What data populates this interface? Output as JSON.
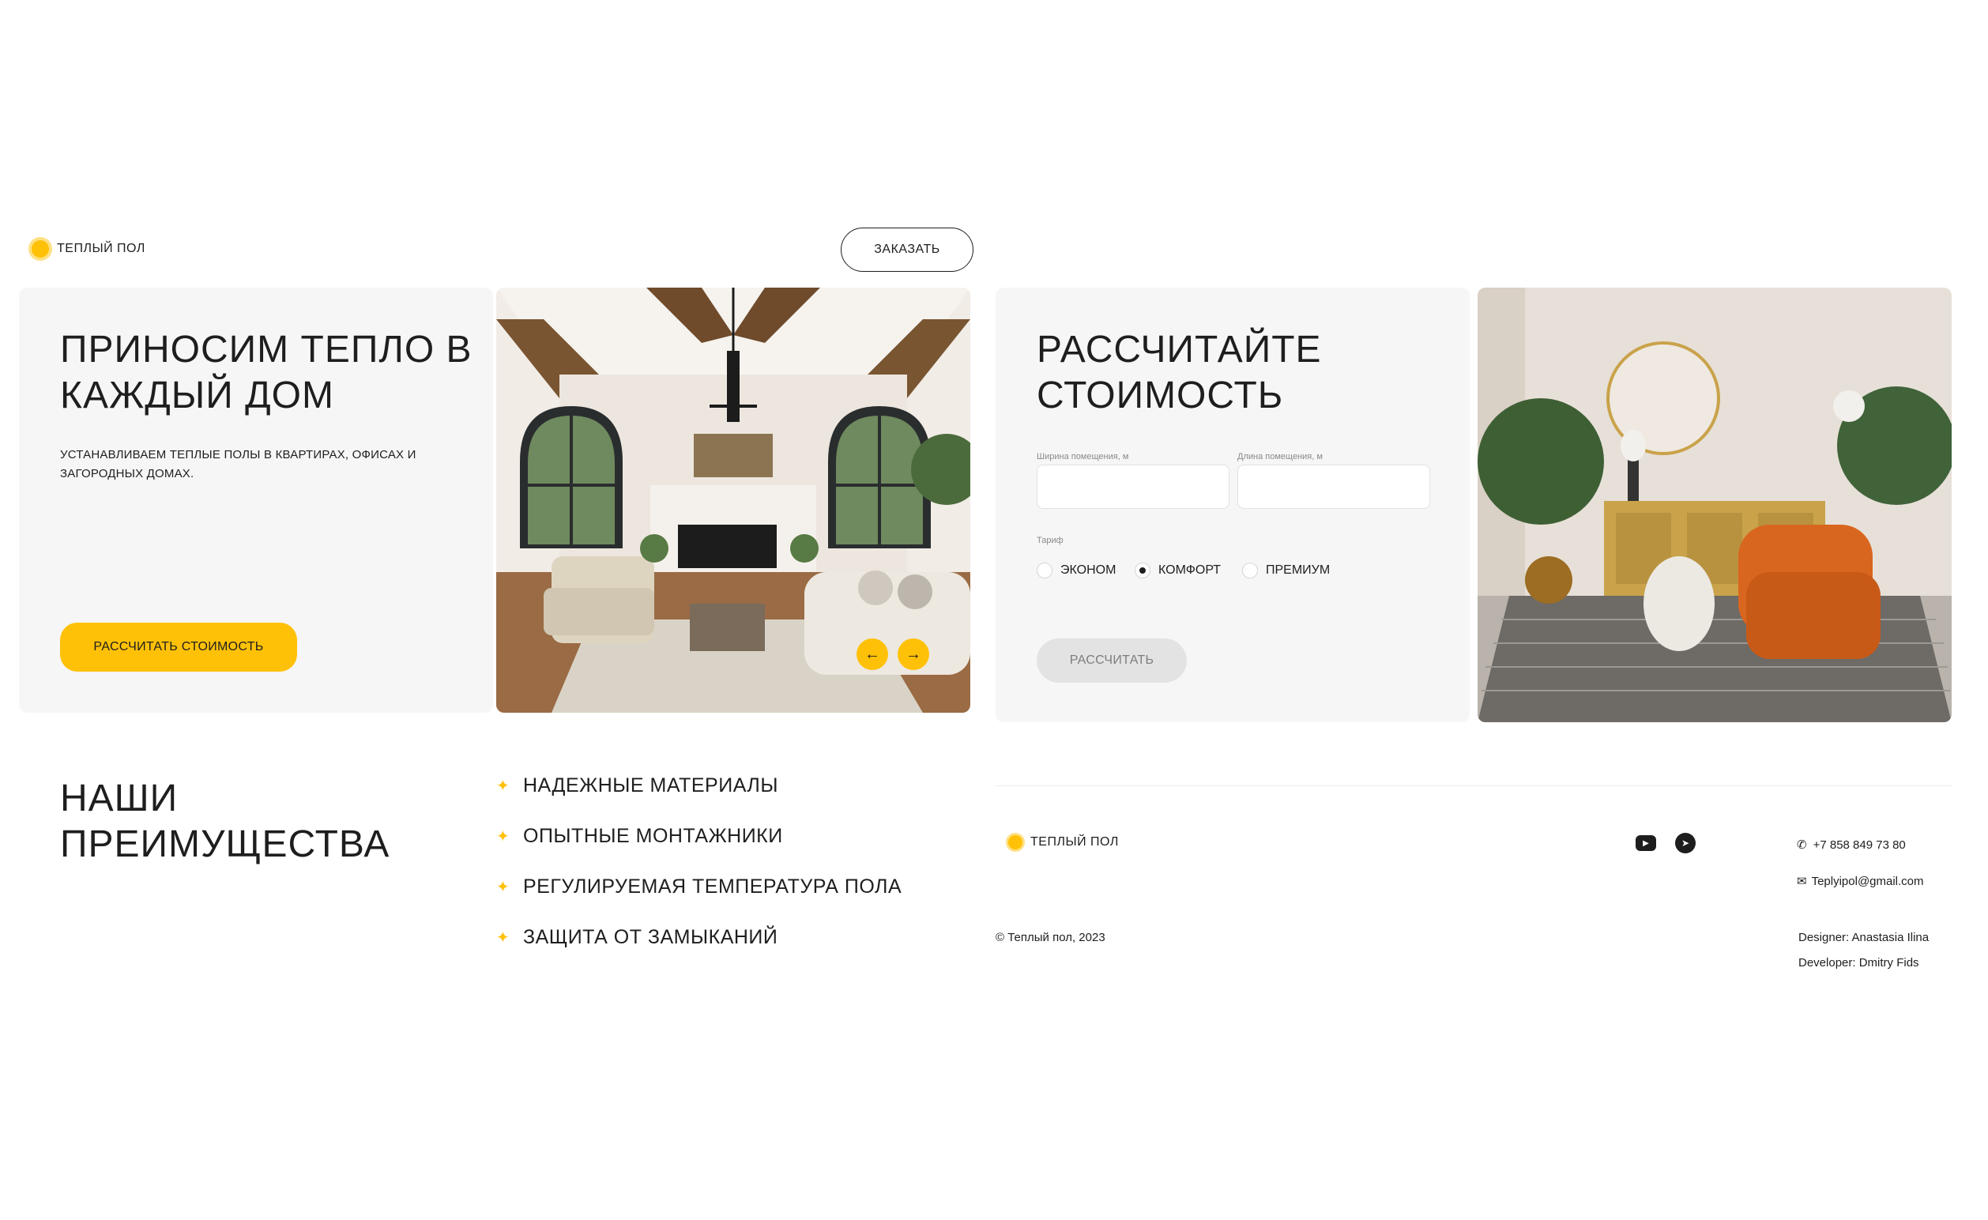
{
  "header": {
    "logo_text": "ТЕПЛЫЙ ПОЛ",
    "order_button": "ЗАКАЗАТЬ"
  },
  "hero": {
    "title": "ПРИНОСИМ ТЕПЛО В КАЖДЫЙ ДОМ",
    "subtitle": "УСТАНАВЛИВАЕМ ТЕПЛЫЕ ПОЛЫ В КВАРТИРАХ, ОФИСАХ И ЗАГОРОДНЫХ ДОМАХ.",
    "cta": "РАССЧИТАТЬ СТОИМОСТЬ",
    "prev_icon": "arrow-left-icon",
    "next_icon": "arrow-right-icon"
  },
  "calculator": {
    "title": "РАССЧИТАЙТЕ СТОИМОСТЬ",
    "width_label": "Ширина помещения, м",
    "length_label": "Длина помещения, м",
    "width_value": "",
    "length_value": "",
    "tariff_label": "Тариф",
    "tariffs": [
      {
        "label": "ЭКОНОМ",
        "checked": false
      },
      {
        "label": "КОМФОРТ",
        "checked": true
      },
      {
        "label": "ПРЕМИУМ",
        "checked": false
      }
    ],
    "submit": "РАССЧИТАТЬ"
  },
  "advantages": {
    "title": "НАШИ ПРЕИМУЩЕСТВА",
    "items": [
      "НАДЕЖНЫЕ МАТЕРИАЛЫ",
      "ОПЫТНЫЕ МОНТАЖНИКИ",
      "РЕГУЛИРУЕМАЯ ТЕМПЕРАТУРА ПОЛА",
      "ЗАЩИТА ОТ ЗАМЫКАНИЙ"
    ]
  },
  "footer": {
    "logo_text": "ТЕПЛЫЙ ПОЛ",
    "copyright": "© Теплый пол, 2023",
    "phone": "+7 858 849 73 80",
    "email": "Teplyipol@gmail.com",
    "designer": "Designer: Anastasia Ilina",
    "developer": "Developer: Dmitry Fids",
    "social_icons": [
      "youtube-icon",
      "telegram-icon"
    ]
  },
  "colors": {
    "accent": "#ffc107",
    "card_bg": "#f6f6f6",
    "text": "#1e1e1e"
  }
}
